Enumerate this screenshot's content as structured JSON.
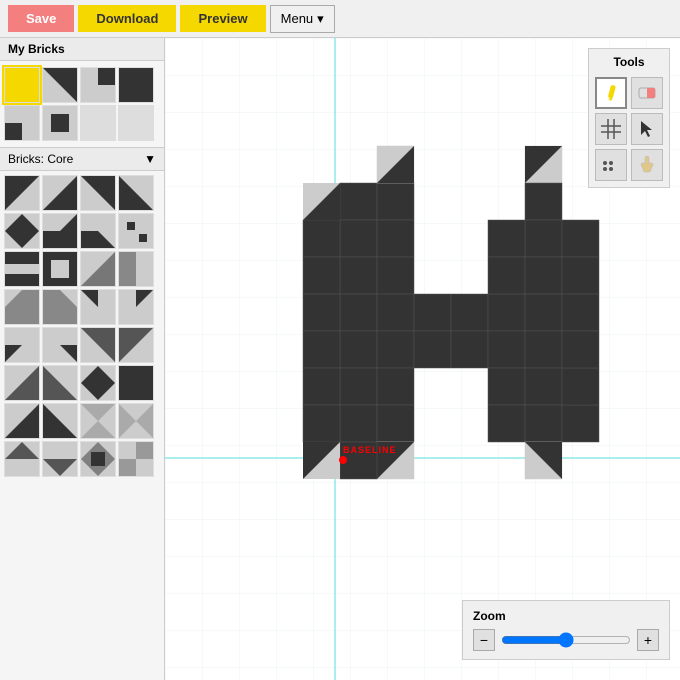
{
  "toolbar": {
    "save_label": "Save",
    "download_label": "Download",
    "preview_label": "Preview",
    "menu_label": "Menu"
  },
  "left_panel": {
    "my_bricks_title": "My Bricks",
    "bricks_core_title": "Bricks: Core",
    "dropdown_icon": "▼"
  },
  "tools": {
    "title": "Tools"
  },
  "zoom": {
    "title": "Zoom",
    "minus_label": "−",
    "plus_label": "+"
  },
  "canvas": {
    "baseline_label": "BASELINE"
  }
}
